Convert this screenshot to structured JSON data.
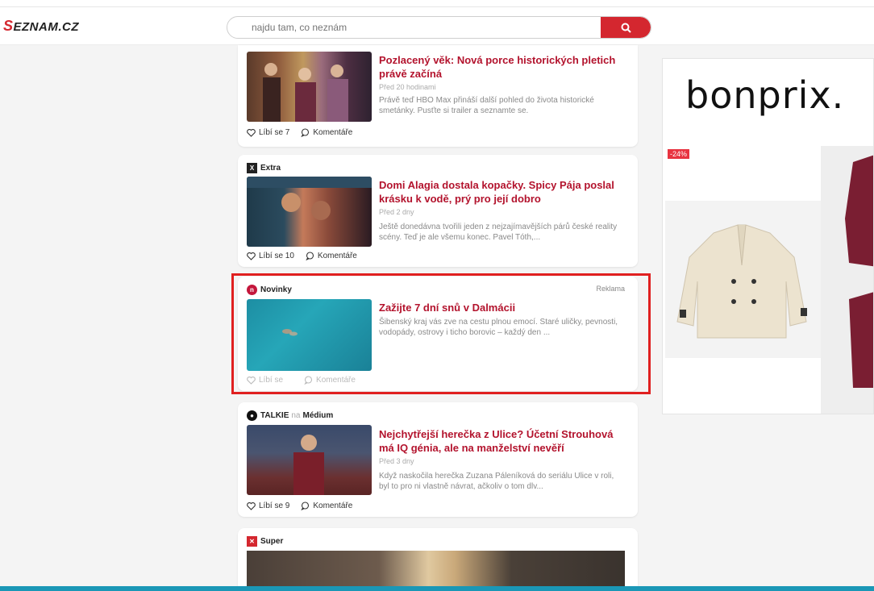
{
  "header": {
    "logo_text": "EZNAM.CZ",
    "logo_first_letter": "S",
    "search_placeholder": "najdu tam, co neznám"
  },
  "feed": [
    {
      "headline": "Pozlacený věk: Nová porce historických pletich právě začíná",
      "time": "Před 20 hodinami",
      "perex": "Právě teď HBO Max přináší další pohled do života historické smetánky. Pusťte si trailer a seznamte se.",
      "likes": "Líbí se 7",
      "comments": "Komentáře"
    },
    {
      "source": "Extra",
      "headline": "Domi Alagia dostala kopačky. Spicy Pája poslal krásku k vodě, prý pro její dobro",
      "time": "Před 2 dny",
      "perex": "Ještě donedávna tvořili jeden z nejzajímavějších párů české reality scény. Teď je ale všemu konec. Pavel Tóth,...",
      "likes": "Líbí se 10",
      "comments": "Komentáře"
    },
    {
      "source": "Novinky",
      "label": "Reklama",
      "headline": "Zažijte 7 dní snů v Dalmácii",
      "perex": "Šibenský kraj vás zve na cestu plnou emocí. Staré uličky, pevnosti, vodopády, ostrovy i ticho borovic – každý den ...",
      "likes": "Líbí se",
      "comments": "Komentáře"
    },
    {
      "source": "TALKIE",
      "source_connector": "na",
      "source_suffix": "Médium",
      "headline": "Nejchytřejší herečka z Ulice? Účetní Strouhová má IQ génia, ale na manželství nevěří",
      "time": "Před 3 dny",
      "perex": "Když naskočila herečka Zuzana Páleníková do seriálu Ulice v roli, byl to pro ni vlastně návrat, ačkoliv o tom dlv...",
      "likes": "Líbí se 9",
      "comments": "Komentáře"
    },
    {
      "source": "Super"
    }
  ],
  "ad": {
    "brand": "bonprix.",
    "discount": "-24%"
  },
  "colors": {
    "accent": "#d4272f",
    "headline": "#b3132d",
    "highlight": "#e02020"
  }
}
